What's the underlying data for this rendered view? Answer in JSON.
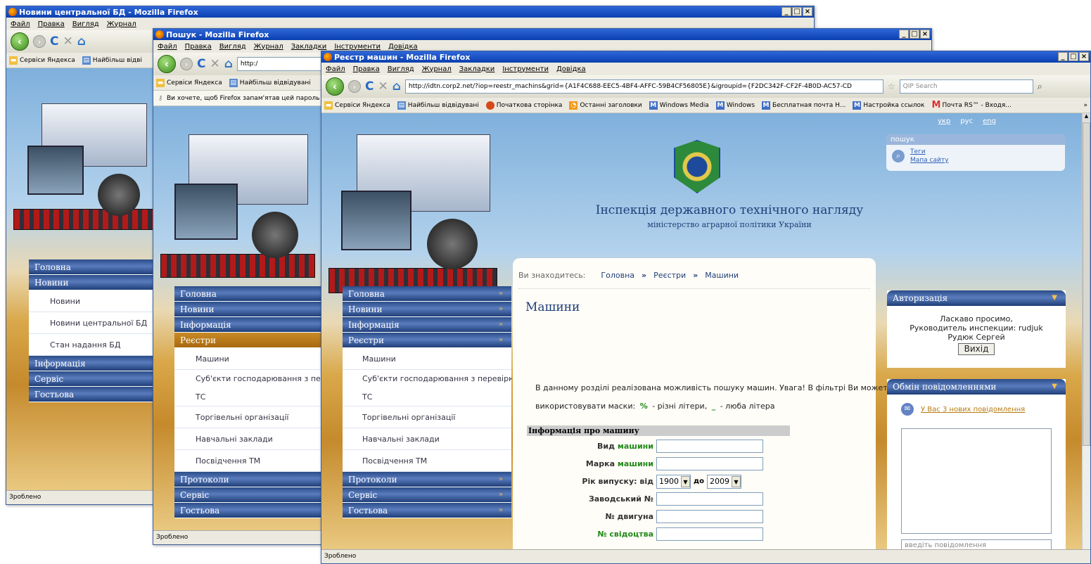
{
  "win1": {
    "title": "Новини центральної БД - Mozilla Firefox",
    "menu": [
      "Файл",
      "Правка",
      "Вигляд",
      "Журнал"
    ],
    "bookmarks": [
      "Сервіси Яндекса",
      "Найбільш відві"
    ],
    "sidebar": {
      "items": [
        "Головна",
        "Новини"
      ],
      "sub": [
        "Новини",
        "Новини центральної БД",
        "Стан надання БД"
      ],
      "items2": [
        "Інформація",
        "Сервіс",
        "Гостьова"
      ]
    },
    "status": "Зроблено"
  },
  "win2": {
    "title": "Пошук - Mozilla Firefox",
    "menu": [
      "Файл",
      "Правка",
      "Вигляд",
      "Журнал",
      "Закладки",
      "Інструменти",
      "Довідка"
    ],
    "url": "http:/",
    "bookmarks": [
      "Сервіси Яндекса",
      "Найбільш відвідувані"
    ],
    "password_bar": "Ви хочете, щоб Firefox запам'ятав цей пароль",
    "sidebar": {
      "items": [
        "Головна",
        "Новини",
        "Інформація"
      ],
      "active": "Реєстри",
      "sub": [
        "Машини",
        "Суб'єкти господарювання з пере",
        "ТС",
        "Торгівельні організації",
        "Навчальні заклади",
        "Посвідчення ТМ"
      ],
      "items2": [
        "Протоколи",
        "Сервіс",
        "Гостьова"
      ]
    },
    "status": "Зроблено"
  },
  "win3": {
    "title": "Реєстр машин - Mozilla Firefox",
    "menu": [
      "Файл",
      "Правка",
      "Вигляд",
      "Журнал",
      "Закладки",
      "Інструменти",
      "Довідка"
    ],
    "url": "http://idtn.corp2.net/?iop=reestr_machins&grid={A1F4C688-EEC5-4BF4-AFFC-59B4CF56805E}&igroupid={F2DC342F-CF2F-4B0D-AC57-CD",
    "search_placeholder": "QIP Search",
    "bookmarks": [
      "Сервіси Яндекса",
      "Найбільш відвідувані",
      "Початкова сторінка",
      "Останні заголовки",
      "Windows Media",
      "Windows",
      "Бесплатная почта Н...",
      "Настройка ссылок",
      "Почта RS™ - Входя..."
    ],
    "langs": [
      "укр",
      "рус",
      "eng"
    ],
    "search_box": {
      "label": "пошук",
      "links": [
        "Теги",
        "Мапа сайту"
      ]
    },
    "org_name": "Інспекція державного технічного нагляду",
    "org_sub": "міністерство аграрної політики України",
    "breadcrumb": {
      "prefix": "Ви знаходитесь:",
      "items": [
        "Головна",
        "Реєстри",
        "Машини"
      ],
      "sep": "»"
    },
    "page_title": "Машини",
    "intro": "В данному розділі реалізована можливість пошуку машин. Увага! В фільтрі Ви можете",
    "intro2_a": "використовувати маски:",
    "mask1": "%",
    "intro2_b": "- різні літери,",
    "mask2": "_",
    "intro2_c": "- люба літера",
    "form": {
      "section": "Інформація про машину",
      "vid_a": "Вид",
      "vid_b": "машини",
      "marka_a": "Марка",
      "marka_b": "машини",
      "year_label": "Рік випуску: від",
      "year_from": "1900",
      "year_to_label": "до",
      "year_to": "2009",
      "serial": "Заводський №",
      "engine": "№ двигуна",
      "cert": "№ свідоцтва"
    },
    "sidebar": {
      "items": [
        "Головна",
        "Новини",
        "Інформація"
      ],
      "active": "Реєстри",
      "sub": [
        "Машини",
        "Суб'єкти господарювання з перевірки",
        "ТС",
        "Торгівельні організації",
        "Навчальні заклади",
        "Посвідчення ТМ"
      ],
      "items2": [
        "Протоколи",
        "Сервіс",
        "Гостьова"
      ]
    },
    "auth": {
      "title": "Авторизація",
      "welcome": "Ласкаво просимо,",
      "role": "Руководитель инспекции: rudjuk",
      "name": "Рудюк Сергей",
      "logout": "Вихід"
    },
    "messages": {
      "title": "Обмін повідомленнями",
      "link": "У Вас 3 нових повідомлення",
      "placeholder": "введіть повідомлення"
    },
    "status": "Зроблено"
  }
}
